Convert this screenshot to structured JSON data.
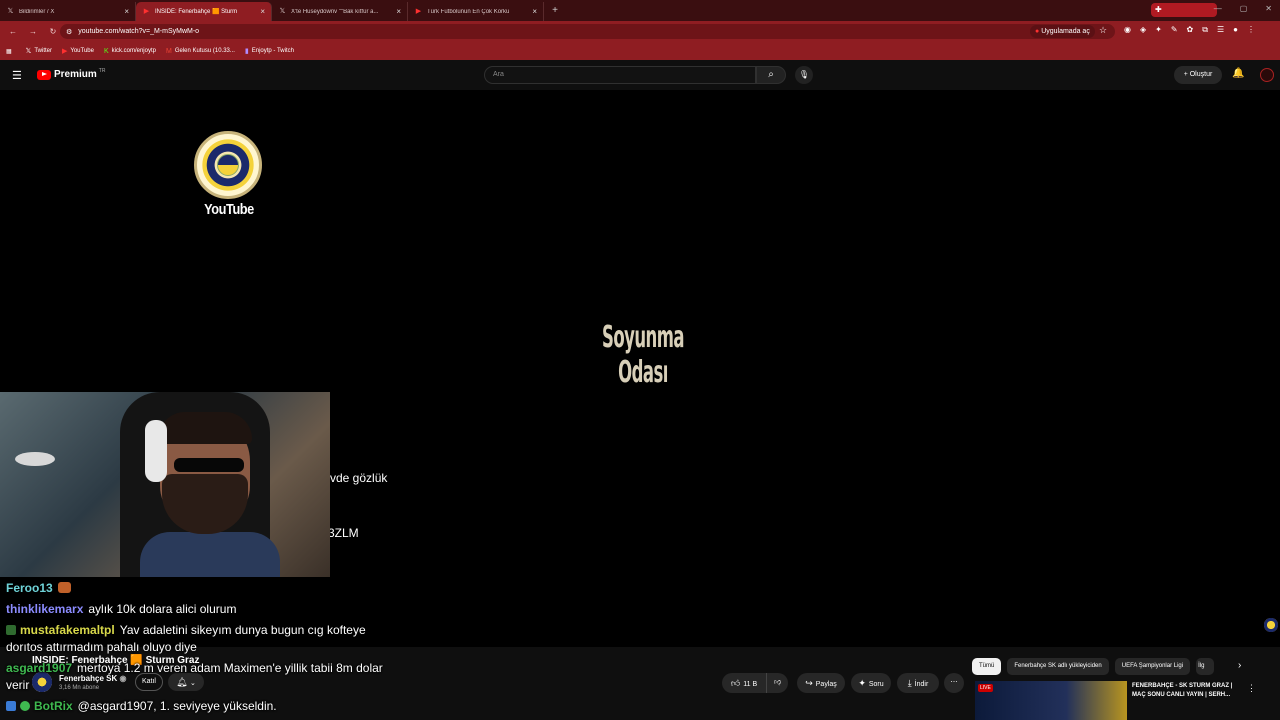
{
  "browser": {
    "tabs": [
      {
        "title": "Bildirimler / X",
        "favicon": "x-icon",
        "active": false
      },
      {
        "title": "INSIDE: Fenerbahçe 🟧 Sturm",
        "favicon": "youtube-icon",
        "active": true
      },
      {
        "title": "X'te Huseydownv \"\"Bak kıtfür a...",
        "favicon": "x-icon",
        "active": false
      },
      {
        "title": "Türk Futbolunun En Çok Korku",
        "favicon": "youtube-icon",
        "active": false
      }
    ],
    "new_tab_label": "+",
    "url": "youtube.com/watch?v=_M-mSyMwM-o",
    "open_app_label": "Uygulamada aç",
    "bookmarks": [
      {
        "label": "Twitter",
        "icon": "x-icon"
      },
      {
        "label": "YouTube",
        "icon": "youtube-icon"
      },
      {
        "label": "kick.com/enjoytp",
        "icon": "kick-icon"
      },
      {
        "label": "Gelen Kutusu (10.33...",
        "icon": "gmail-icon"
      },
      {
        "label": "Enjoytp - Twitch",
        "icon": "twitch-icon"
      }
    ]
  },
  "youtube": {
    "logo_text": "Premium",
    "country": "TR",
    "search_placeholder": "Ara",
    "create_label": "Oluştur"
  },
  "video": {
    "crest_label": "YouTube",
    "overlay_title": "Soyunma Odası",
    "cut_text_1": "vde gözlük",
    "cut_text_2": "3ZLM"
  },
  "chat": [
    {
      "user": "Feroo13",
      "user_color": "#6fd3d8",
      "message": "",
      "badge": "emote"
    },
    {
      "user": "thinklikemarx",
      "user_color": "#8c8cff",
      "message": "aylık 10k dolara alici olurum"
    },
    {
      "user": "mustafakemaltpl",
      "user_color": "#d8d84a",
      "message": "Yav adaletini sikeyım dunya bugun cıg kofteye dorıtos attırmadım pahalı oluyo diye",
      "badge": "leaf"
    },
    {
      "user": "asgard1907",
      "user_color": "#3fb950",
      "message": "mertoya 1.2 m veren adam Maximen'e yillik tabii 8m dolar verir"
    },
    {
      "user": "BotRix",
      "user_color": "#3fb950",
      "message": "@asgard1907, 1. seviyeye yükseldin.",
      "badge": "bot"
    }
  ],
  "info": {
    "video_title": "INSIDE: Fenerbahçe 🟧 Sturm Graz",
    "channel_name": "Fenerbahçe SK",
    "subscribers": "3,16 Mn abone",
    "join_label": "Katıl",
    "like_count": "11 B",
    "share_label": "Paylaş",
    "ask_label": "Soru",
    "download_label": "İndir"
  },
  "sidebar": {
    "chips": [
      "Tümü",
      "Fenerbahçe SK adlı yükleyiciden",
      "UEFA Şampiyonlar Ligi",
      "İlg"
    ],
    "rec_title": "FENERBAHÇE - SK STURM GRAZ | MAÇ SONU CANLI YAYIN | SERH...",
    "rec_badge": "LIVE"
  }
}
